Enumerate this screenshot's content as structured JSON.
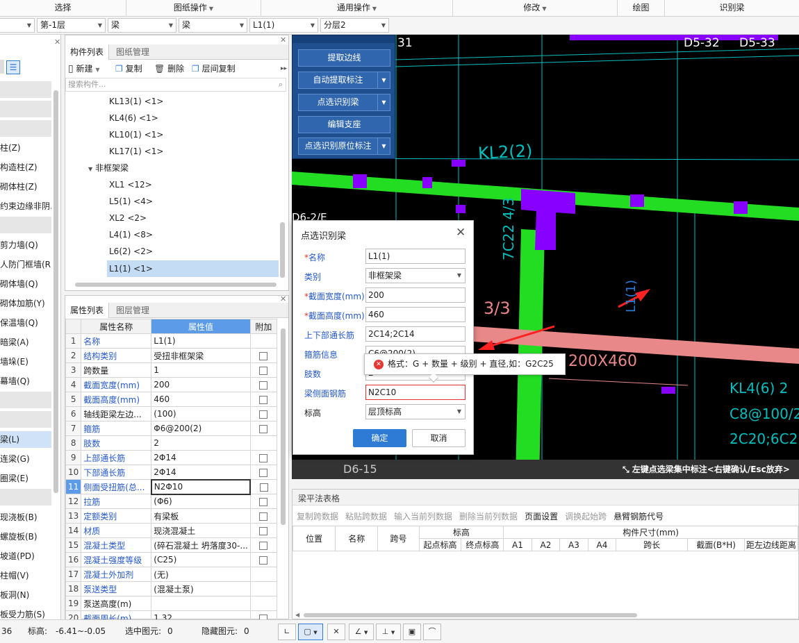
{
  "ribbon": {
    "sections": [
      "选择",
      "图纸操作",
      "通用操作",
      "修改",
      "绘图",
      "识别梁"
    ]
  },
  "selectors": [
    "第-1层",
    "梁",
    "梁",
    "L1(1)",
    "分层2"
  ],
  "left_nav": [
    "柱(Z)",
    "构造柱(Z)",
    "砌体柱(Z)",
    "约束边缘非阴...",
    "剪力墙(Q)",
    "人防门框墙(RF",
    "砌体墙(Q)",
    "砌体加筋(Y)",
    "保温墙(Q)",
    "暗梁(A)",
    "墙垛(E)",
    "幕墙(Q)",
    "梁(L)",
    "连梁(G)",
    "圈梁(E)",
    "现浇板(B)",
    "螺旋板(B)",
    "坡道(PD)",
    "柱帽(V)",
    "板洞(N)",
    "板受力筋(S)"
  ],
  "component_panel": {
    "tabs": [
      "构件列表",
      "图纸管理"
    ],
    "toolbar": {
      "new": "新建",
      "copy": "复制",
      "delete": "删除",
      "floor_copy": "层间复制"
    },
    "search_placeholder": "搜索构件...",
    "tree": {
      "items_top": [
        "KL13(1) <1>",
        "KL4(6) <1>",
        "KL10(1) <1>",
        "KL17(1) <1>"
      ],
      "group": "非框架梁",
      "items_sub": [
        "XL1 <12>",
        "L5(1) <4>",
        "XL2 <2>",
        "L4(1) <8>",
        "L6(2) <2>",
        "L1(1) <1>"
      ]
    }
  },
  "property_panel": {
    "tabs": [
      "属性列表",
      "图层管理"
    ],
    "headers": [
      "属性名称",
      "属性值",
      "附加"
    ],
    "rows": [
      {
        "n": "1",
        "name": "名称",
        "value": "L1(1)",
        "cb": false,
        "blue": true
      },
      {
        "n": "2",
        "name": "结构类别",
        "value": "受扭非框架梁",
        "cb": true,
        "blue": true
      },
      {
        "n": "3",
        "name": "跨数量",
        "value": "1",
        "cb": true,
        "blue": false
      },
      {
        "n": "4",
        "name": "截面宽度(mm)",
        "value": "200",
        "cb": true,
        "blue": true
      },
      {
        "n": "5",
        "name": "截面高度(mm)",
        "value": "460",
        "cb": true,
        "blue": true
      },
      {
        "n": "6",
        "name": "轴线距梁左边...",
        "value": "(100)",
        "cb": true,
        "blue": false
      },
      {
        "n": "7",
        "name": "箍筋",
        "value": "Φ6@200(2)",
        "cb": true,
        "blue": true
      },
      {
        "n": "8",
        "name": "肢数",
        "value": "2",
        "cb": false,
        "blue": true
      },
      {
        "n": "9",
        "name": "上部通长筋",
        "value": "2Φ14",
        "cb": true,
        "blue": true
      },
      {
        "n": "10",
        "name": "下部通长筋",
        "value": "2Φ14",
        "cb": true,
        "blue": true
      },
      {
        "n": "11",
        "name": "侧面受扭筋(总...",
        "value": "N2Φ10",
        "cb": true,
        "blue": true
      },
      {
        "n": "12",
        "name": "拉筋",
        "value": "(Φ6)",
        "cb": true,
        "blue": true
      },
      {
        "n": "13",
        "name": "定额类别",
        "value": "有梁板",
        "cb": true,
        "blue": true
      },
      {
        "n": "14",
        "name": "材质",
        "value": "现浇混凝土",
        "cb": true,
        "blue": true
      },
      {
        "n": "15",
        "name": "混凝土类型",
        "value": "(碎石混凝土 坍落度30-...",
        "cb": true,
        "blue": true
      },
      {
        "n": "16",
        "name": "混凝土强度等级",
        "value": "(C25)",
        "cb": true,
        "blue": true
      },
      {
        "n": "17",
        "name": "混凝土外加剂",
        "value": "(无)",
        "cb": false,
        "blue": true
      },
      {
        "n": "18",
        "name": "泵送类型",
        "value": "(混凝土泵)",
        "cb": false,
        "blue": true
      },
      {
        "n": "19",
        "name": "泵送高度(m)",
        "value": "",
        "cb": false,
        "blue": false
      },
      {
        "n": "20",
        "name": "截面周长(m)",
        "value": "1.32",
        "cb": true,
        "blue": true
      }
    ]
  },
  "float_toolbar": {
    "buttons": [
      "提取边线",
      "自动提取标注",
      "点选识别梁",
      "编辑支座",
      "点选识别原位标注"
    ]
  },
  "cad_labels": {
    "top1": "31",
    "top2": "D5-32",
    "top3": "D5-33",
    "kl2": "KL2(2)",
    "d6": "D6-2/E",
    "sec43": "7C22 4/3",
    "s33": "3/3",
    "l11": "L1(1)",
    "size": "200X460",
    "kl4a": "KL4(6) 2",
    "kl4b": "C8@100/2",
    "kl4c": "2C20;6C2",
    "d615": "D6-15"
  },
  "canvas_status": "左键点选梁集中标注<右键确认/Esc放弃>",
  "dialog": {
    "title": "点选识别梁",
    "fields": [
      {
        "label": "名称",
        "value": "L1(1)",
        "req": true,
        "kind": "text"
      },
      {
        "label": "类别",
        "value": "非框架梁",
        "req": false,
        "kind": "select"
      },
      {
        "label": "截面宽度(mm)",
        "value": "200",
        "req": true,
        "kind": "text"
      },
      {
        "label": "截面高度(mm)",
        "value": "460",
        "req": true,
        "kind": "text"
      },
      {
        "label": "上下部通长筋",
        "value": "2C14;2C14",
        "req": false,
        "kind": "text"
      },
      {
        "label": "箍筋信息",
        "value": "C6@200(2)",
        "req": false,
        "kind": "text"
      },
      {
        "label": "肢数",
        "value": "2",
        "req": false,
        "kind": "text"
      },
      {
        "label": "梁侧面钢筋",
        "value": "N2C10",
        "req": false,
        "kind": "error"
      },
      {
        "label": "标高",
        "value": "层顶标高",
        "req": false,
        "kind": "select"
      }
    ],
    "ok": "确定",
    "cancel": "取消",
    "tooltip": "格式：G + 数量 + 级别 + 直径,如：G2C25"
  },
  "bottom_panel": {
    "title": "梁平法表格",
    "toolbar": [
      "复制跨数据",
      "粘贴跨数据",
      "输入当前列数据",
      "删除当前列数据",
      "页面设置",
      "调换起始跨",
      "悬臂钢筋代号"
    ],
    "cols": [
      "位置",
      "名称",
      "跨号"
    ],
    "group_biaogao": "标高",
    "biaogao_sub": [
      "起点标高",
      "终点标高"
    ],
    "group_size": "构件尺寸(mm)",
    "size_sub": [
      "A1",
      "A2",
      "A3",
      "A4",
      "跨长",
      "截面(B*H)",
      "距左边线距离"
    ]
  },
  "statusbar": {
    "left": "36",
    "elev_label": "标高:",
    "elev": "-6.41~-0.05",
    "sel_label": "选中图元:",
    "sel": "0",
    "hid_label": "隐藏图元:",
    "hid": "0"
  },
  "colors": {
    "cad_green": "#22dd22",
    "cad_purple": "#8800ff",
    "cad_pink": "#e88888",
    "cad_cyan": "#00bfbf",
    "float_bg": "#1f4f8f",
    "accent": "#2e7bd6"
  }
}
